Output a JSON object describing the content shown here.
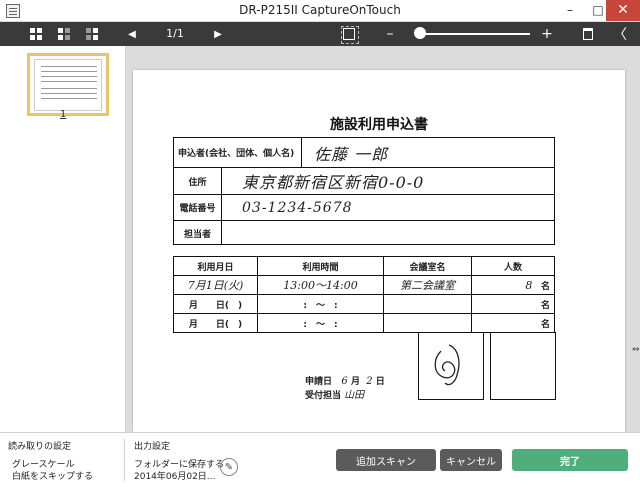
{
  "window": {
    "title": "DR-P215II CaptureOnTouch",
    "minimize": "–",
    "maximize": "□",
    "close": "✕"
  },
  "toolbar": {
    "page_indicator": "1/1",
    "prev_label": "◀",
    "next_label": "▶",
    "zoom_out": "–",
    "zoom_in": "+",
    "collapse": "〈",
    "zoom_level": 0.0
  },
  "thumbnails": [
    {
      "label": "1"
    }
  ],
  "document": {
    "title": "施設利用申込書",
    "applicant_label": "申込者(会社、団体、個人名)",
    "applicant_value": "佐藤 一郎",
    "address_label": "住所",
    "address_value": "東京都新宿区新宿0-0-0",
    "phone_label": "電話番号",
    "phone_value": "03-1234-5678",
    "contact_label": "担当者",
    "contact_value": "",
    "table_headers": [
      "利用月日",
      "利用時間",
      "会議室名",
      "人数"
    ],
    "rows": [
      {
        "date": "7月1日(火)",
        "time": "13:00〜14:00",
        "room": "第二会議室",
        "people": "8",
        "unit": "名"
      },
      {
        "date": "月　　日(　)",
        "time": ":　〜　:",
        "room": "",
        "people": "",
        "unit": "名"
      },
      {
        "date": "月　　日(　)",
        "time": ":　〜　:",
        "room": "",
        "people": "",
        "unit": "名"
      }
    ],
    "applied_label": "申請日",
    "applied_month": "6",
    "applied_month_unit": "月",
    "applied_day": "2",
    "applied_day_unit": "日",
    "receiver_label": "受付担当",
    "receiver_value": "山田"
  },
  "bottom": {
    "scan_settings_title": "読み取りの設定",
    "scan_setting_1": "グレースケール",
    "scan_setting_2": "白紙をスキップする",
    "output_settings_title": "出力設定",
    "output_setting_1": "フォルダーに保存する",
    "output_setting_2": "2014年06月02日...",
    "additional_scan": "追加スキャン",
    "cancel": "キャンセル",
    "done": "完了"
  },
  "colors": {
    "toolbar_bg": "#3a3a3a",
    "accent_done": "#4fae7b",
    "thumb_selected": "#e8c46a",
    "close_red": "#c7463b"
  }
}
